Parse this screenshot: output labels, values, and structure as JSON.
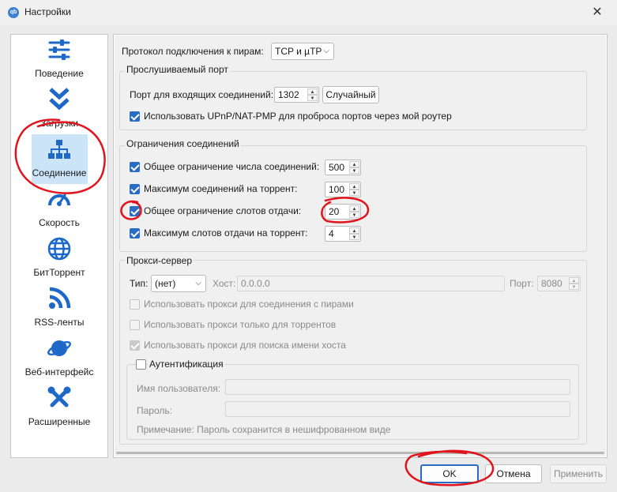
{
  "window": {
    "title": "Настройки",
    "app_icon": "qb"
  },
  "sidebar": {
    "items": [
      {
        "label": "Поведение",
        "icon": "sliders-icon"
      },
      {
        "label": "Загрузки",
        "icon": "double-chevron-down-icon"
      },
      {
        "label": "Соединение",
        "icon": "network-icon",
        "active": true
      },
      {
        "label": "Скорость",
        "icon": "speedometer-icon"
      },
      {
        "label": "БитТоррент",
        "icon": "globe-icon"
      },
      {
        "label": "RSS-ленты",
        "icon": "rss-icon"
      },
      {
        "label": "Веб-интерфейс",
        "icon": "planet-icon"
      },
      {
        "label": "Расширенные",
        "icon": "tools-icon"
      }
    ]
  },
  "connection": {
    "protocol_label": "Протокол подключения к пирам:",
    "protocol_value": "TCP и µTP",
    "listening": {
      "title": "Прослушиваемый порт",
      "port_label": "Порт для входящих соединений:",
      "port_value": "1302",
      "random_button": "Случайный",
      "upnp_label": "Использовать UPnP/NAT-PMP для проброса портов через мой роутер"
    },
    "limits": {
      "title": "Ограничения соединений",
      "rows": [
        {
          "label": "Общее ограничение числа соединений:",
          "value": "500"
        },
        {
          "label": "Максимум соединений на торрент:",
          "value": "100"
        },
        {
          "label": "Общее ограничение слотов отдачи:",
          "value": "20"
        },
        {
          "label": "Максимум слотов отдачи на торрент:",
          "value": "4"
        }
      ]
    },
    "proxy": {
      "title": "Прокси-сервер",
      "type_label": "Тип:",
      "type_value": "(нет)",
      "host_label": "Хост:",
      "host_value": "0.0.0.0",
      "port_label": "Порт:",
      "port_value": "8080",
      "opt_peers": "Использовать прокси для соединения с пирами",
      "opt_torrents": "Использовать прокси только для торрентов",
      "opt_hostname": "Использовать прокси для поиска имени хоста",
      "auth": {
        "title": "Аутентификация",
        "username_label": "Имя пользователя:",
        "password_label": "Пароль:",
        "note": "Примечание: Пароль сохранится в нешифрованном виде"
      }
    }
  },
  "footer": {
    "ok": "OK",
    "cancel": "Отмена",
    "apply": "Применить"
  },
  "colors": {
    "accent": "#2a6cc4",
    "selection": "#cce4f7",
    "annotation": "#e0141c"
  }
}
